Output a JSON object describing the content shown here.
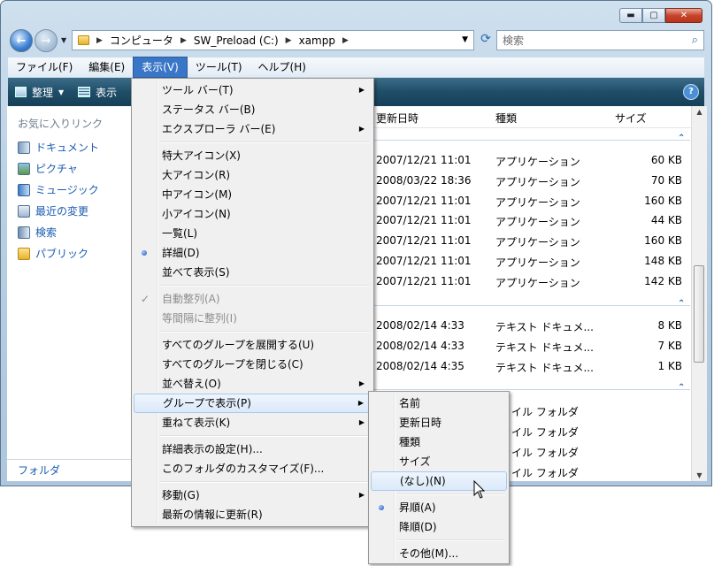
{
  "window": {
    "caption_buttons": [
      "minimize",
      "maximize",
      "close"
    ]
  },
  "address": {
    "segments": [
      "コンピュータ",
      "SW_Preload (C:)",
      "xampp"
    ]
  },
  "search": {
    "placeholder": "検索"
  },
  "menubar": {
    "items": [
      "ファイル(F)",
      "編集(E)",
      "表示(V)",
      "ツール(T)",
      "ヘルプ(H)"
    ],
    "active": "表示(V)"
  },
  "toolbar": {
    "organize": "整理",
    "views": "表示"
  },
  "nav": {
    "header": "お気に入りリンク",
    "links": [
      {
        "label": "ドキュメント",
        "icon": "documents-icon"
      },
      {
        "label": "ピクチャ",
        "icon": "pictures-icon"
      },
      {
        "label": "ミュージック",
        "icon": "music-icon"
      },
      {
        "label": "最近の変更",
        "icon": "recent-icon"
      },
      {
        "label": "検索",
        "icon": "search-folder-icon"
      },
      {
        "label": "パブリック",
        "icon": "public-folder-icon"
      }
    ],
    "footer": "フォルダ"
  },
  "columns": {
    "modified": "更新日時",
    "type": "種類",
    "size": "サイズ"
  },
  "rows": [
    {
      "date": "2007/12/21 11:01",
      "type": "アプリケーション",
      "size": "60 KB"
    },
    {
      "date": "2008/03/22 18:36",
      "type": "アプリケーション",
      "size": "70 KB"
    },
    {
      "date": "2007/12/21 11:01",
      "type": "アプリケーション",
      "size": "160 KB"
    },
    {
      "date": "2007/12/21 11:01",
      "type": "アプリケーション",
      "size": "44 KB"
    },
    {
      "date": "2007/12/21 11:01",
      "type": "アプリケーション",
      "size": "160 KB"
    },
    {
      "date": "2007/12/21 11:01",
      "type": "アプリケーション",
      "size": "148 KB"
    },
    {
      "date": "2007/12/21 11:01",
      "type": "アプリケーション",
      "size": "142 KB"
    },
    {
      "date": "2008/02/14 4:33",
      "type": "テキスト ドキュメ...",
      "size": "8 KB"
    },
    {
      "date": "2008/02/14 4:33",
      "type": "テキスト ドキュメ...",
      "size": "7 KB"
    },
    {
      "date": "2008/02/14 4:35",
      "type": "テキスト ドキュメ...",
      "size": "1 KB"
    },
    {
      "date": "",
      "type": "ァイル フォルダ",
      "size": ""
    },
    {
      "date": "",
      "type": "ァイル フォルダ",
      "size": ""
    },
    {
      "date": "",
      "type": "ァイル フォルダ",
      "size": ""
    },
    {
      "date": "",
      "type": "ァイル フォルダ",
      "size": ""
    }
  ],
  "view_menu": {
    "toolbars": "ツール バー(T)",
    "statusbar": "ステータス バー(B)",
    "explorer_bar": "エクスプローラ バー(E)",
    "xl_icons": "特大アイコン(X)",
    "large_icons": "大アイコン(R)",
    "medium_icons": "中アイコン(M)",
    "small_icons": "小アイコン(N)",
    "list": "一覧(L)",
    "details": "詳細(D)",
    "tiles": "並べて表示(S)",
    "auto_arrange": "自動整列(A)",
    "align_grid": "等間隔に整列(I)",
    "expand_groups": "すべてのグループを展開する(U)",
    "collapse_groups": "すべてのグループを閉じる(C)",
    "sort_by": "並べ替え(O)",
    "group_by": "グループで表示(P)",
    "stack_by": "重ねて表示(K)",
    "choose_details": "詳細表示の設定(H)...",
    "customize": "このフォルダのカスタマイズ(F)...",
    "goto": "移動(G)",
    "refresh": "最新の情報に更新(R)"
  },
  "group_menu": {
    "name": "名前",
    "modified": "更新日時",
    "type": "種類",
    "size": "サイズ",
    "none": "(なし)(N)",
    "ascending": "昇順(A)",
    "descending": "降順(D)",
    "more": "その他(M)..."
  }
}
